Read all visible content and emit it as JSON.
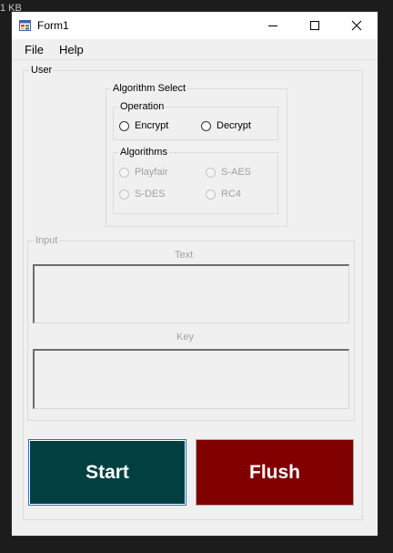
{
  "background_label": "1 KB",
  "window": {
    "title": "Form1",
    "icon": "winforms-form-icon",
    "controls": [
      "minimize-icon",
      "maximize-icon",
      "close-icon"
    ]
  },
  "menu": {
    "items": [
      {
        "label": "File"
      },
      {
        "label": "Help"
      }
    ]
  },
  "user_group": {
    "legend": "User",
    "algorithm_select": {
      "legend": "Algorithm Select",
      "operation": {
        "legend": "Operation",
        "options": [
          {
            "label": "Encrypt",
            "checked": false,
            "enabled": true
          },
          {
            "label": "Decrypt",
            "checked": false,
            "enabled": true
          }
        ]
      },
      "algorithms": {
        "legend": "Algorithms",
        "options": [
          {
            "label": "Playfair",
            "enabled": false
          },
          {
            "label": "S-AES",
            "enabled": false
          },
          {
            "label": "S-DES",
            "enabled": false
          },
          {
            "label": "RC4",
            "enabled": false
          }
        ]
      }
    },
    "input": {
      "legend": "Input",
      "enabled": false,
      "text_label": "Text",
      "text_value": "",
      "key_label": "Key",
      "key_value": ""
    },
    "buttons": {
      "start": {
        "label": "Start",
        "color": "#004040"
      },
      "flush": {
        "label": "Flush",
        "color": "#800000"
      }
    }
  }
}
